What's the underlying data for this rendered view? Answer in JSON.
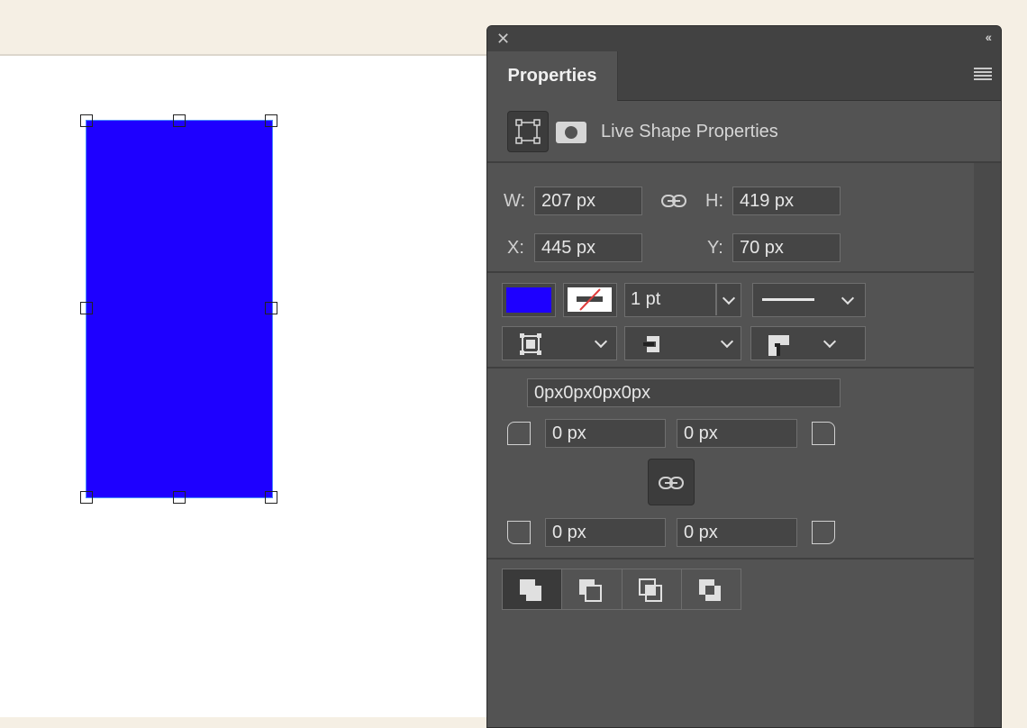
{
  "panel": {
    "title": "Properties",
    "live_shape_label": "Live Shape Properties",
    "transform": {
      "w_label": "W:",
      "w_value": "207 px",
      "h_label": "H:",
      "h_value": "419 px",
      "x_label": "X:",
      "x_value": "445 px",
      "y_label": "Y:",
      "y_value": "70 px"
    },
    "appearance": {
      "fill_color": "#1e00ff",
      "stroke_width": "1 pt"
    },
    "corners": {
      "combined": "0px0px0px0px",
      "top_left": "0 px",
      "top_right": "0 px",
      "bottom_left": "0 px",
      "bottom_right": "0 px"
    }
  },
  "icons": [
    "close-icon",
    "collapse-icon",
    "panel-menu-icon",
    "transform-icon",
    "mask-icon",
    "link-icon"
  ],
  "colors": {
    "shape_fill": "#1e00ff",
    "panel_bg": "#535353",
    "canvas_bg": "#ffffff",
    "workspace_bg": "#f5efe4"
  }
}
